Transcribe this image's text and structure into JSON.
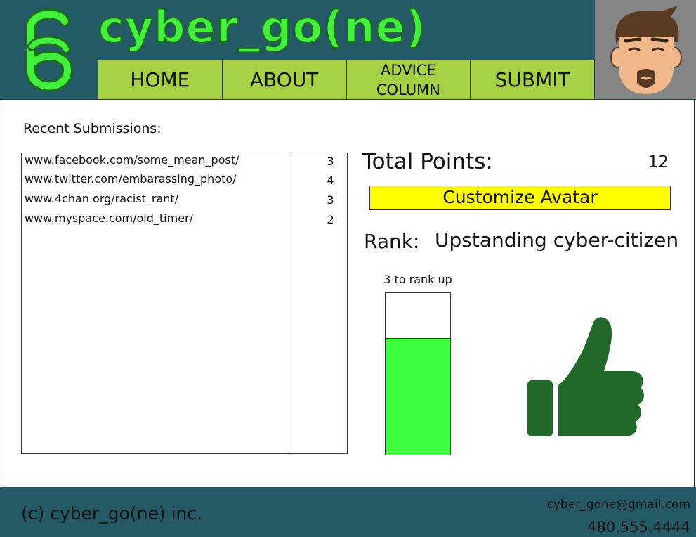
{
  "header": {
    "brand": "cyber_go(ne)",
    "nav": [
      {
        "label": "HOME"
      },
      {
        "label": "ABOUT"
      },
      {
        "label": "ADVICE\nCOLUMN"
      },
      {
        "label": "SUBMIT"
      }
    ]
  },
  "recent": {
    "title": "Recent Submissions:",
    "rows": [
      {
        "url": "www.facebook.com/some_mean_post/",
        "points": "3"
      },
      {
        "url": "www.twitter.com/embarassing_photo/",
        "points": "4"
      },
      {
        "url": "www.4chan.org/racist_rant/",
        "points": "3"
      },
      {
        "url": "www.myspace.com/old_timer/",
        "points": "2"
      }
    ]
  },
  "stats": {
    "total_label": "Total Points:",
    "total_value": "12",
    "customize_label": "Customize Avatar",
    "rank_label": "Rank:",
    "rank_value": "Upstanding cyber-citizen",
    "rank_up_text": "3 to rank up",
    "progress_fraction": 0.72
  },
  "footer": {
    "copyright": "(c) cyber_go(ne) inc.",
    "email": "cyber_gone@gmail.com",
    "phone": "480.555.4444"
  },
  "colors": {
    "header_bg": "#245a66",
    "brand_green": "#41ef3c",
    "nav_bg": "#a7d144",
    "button_yellow": "#ffff00",
    "progress_green": "#40ff40",
    "thumb_green": "#22682a"
  },
  "icons": {
    "logo": "cg-logo-icon",
    "avatar": "cartoon-face-avatar",
    "thumb": "thumbs-up-icon"
  }
}
